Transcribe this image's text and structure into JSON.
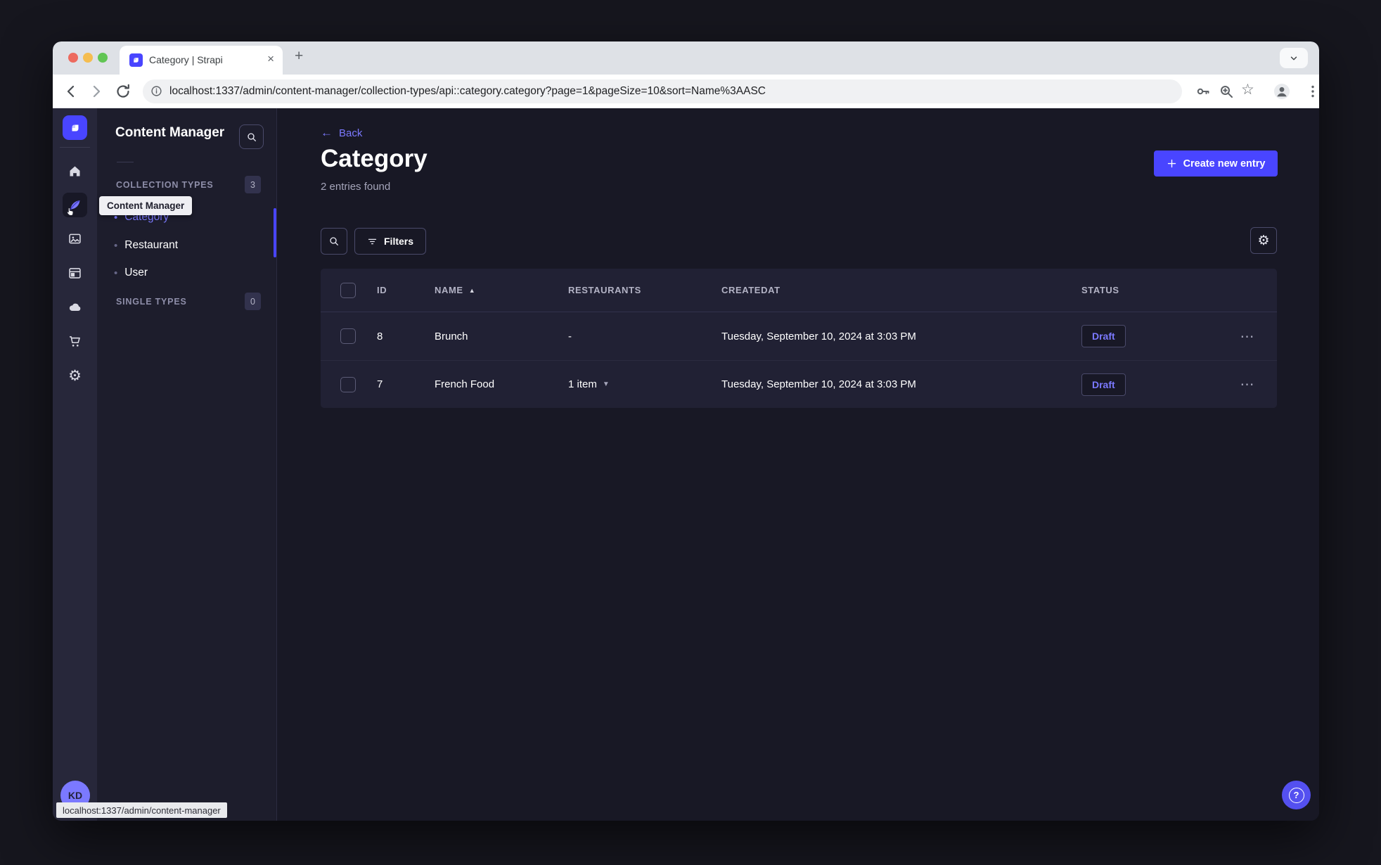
{
  "browser": {
    "tab_title": "Category | Strapi",
    "url": "localhost:1337/admin/content-manager/collection-types/api::category.category?page=1&pageSize=10&sort=Name%3AASC",
    "status_bar_url": "localhost:1337/admin/content-manager"
  },
  "icons": {
    "close": "×",
    "plus": "+",
    "ellipsis": "⋯",
    "star": "☆",
    "gear": "⚙",
    "back_arrow": "←",
    "bullet": "•",
    "sort_asc": "▲",
    "caret_down": "▼",
    "question": "?"
  },
  "sidebar": {
    "tooltip": "Content Manager",
    "avatar_initials": "KD"
  },
  "subnav": {
    "title": "Content Manager",
    "collection_section": {
      "label": "COLLECTION TYPES",
      "badge": "3"
    },
    "items": [
      {
        "label": "Category"
      },
      {
        "label": "Restaurant"
      },
      {
        "label": "User"
      }
    ],
    "single_section": {
      "label": "SINGLE TYPES",
      "badge": "0"
    }
  },
  "main": {
    "back": "Back",
    "title": "Category",
    "subtitle": "2 entries found",
    "create_button": "Create new entry",
    "filters": "Filters",
    "table": {
      "headers": {
        "id": "ID",
        "name": "NAME",
        "restaurants": "RESTAURANTS",
        "createdat": "CREATEDAT",
        "status": "STATUS"
      },
      "rows": [
        {
          "id": "8",
          "name": "Brunch",
          "restaurants": "-",
          "createdat": "Tuesday, September 10, 2024 at 3:03 PM",
          "status": "Draft"
        },
        {
          "id": "7",
          "name": "French Food",
          "restaurants": "1 item",
          "createdat": "Tuesday, September 10, 2024 at 3:03 PM",
          "status": "Draft"
        }
      ]
    }
  },
  "colors": {
    "accent": "#4945ff",
    "accent_light": "#7b79ff"
  }
}
